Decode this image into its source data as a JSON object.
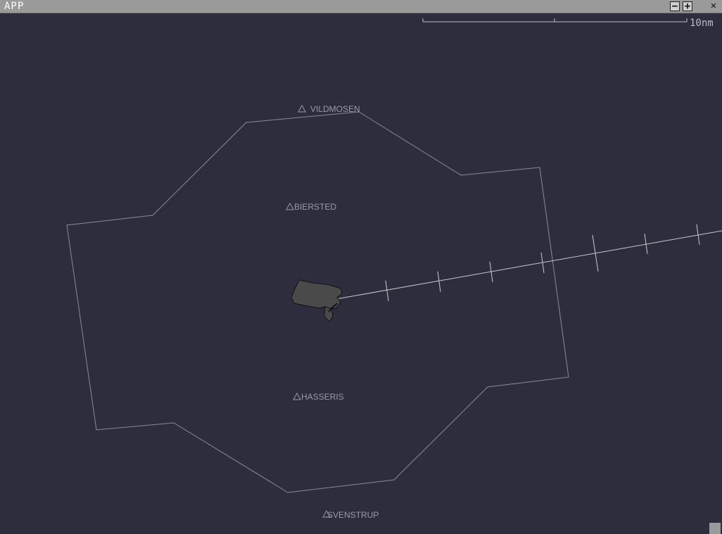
{
  "window": {
    "title": "APP",
    "minimize_glyph": "−",
    "maximize_glyph": "+",
    "close_glyph": "✕"
  },
  "scale_bar": {
    "label": "10nm"
  },
  "points": [
    {
      "name": "VILDMOSEN",
      "icon": "triangle-icon"
    },
    {
      "name": "BIERSTED",
      "icon": "triangle-icon"
    },
    {
      "name": "HASSERIS",
      "icon": "triangle-icon"
    },
    {
      "name": "SVENSTRUP",
      "icon": "triangle-icon"
    }
  ],
  "colors": {
    "background": "#2e2d3e",
    "airspace_outline": "#8a8a96",
    "extended_centerline": "#c8c8d0",
    "airport": "#4a4a4a",
    "label": "#9b9aa8",
    "titlebar": "#9a9a9a"
  }
}
